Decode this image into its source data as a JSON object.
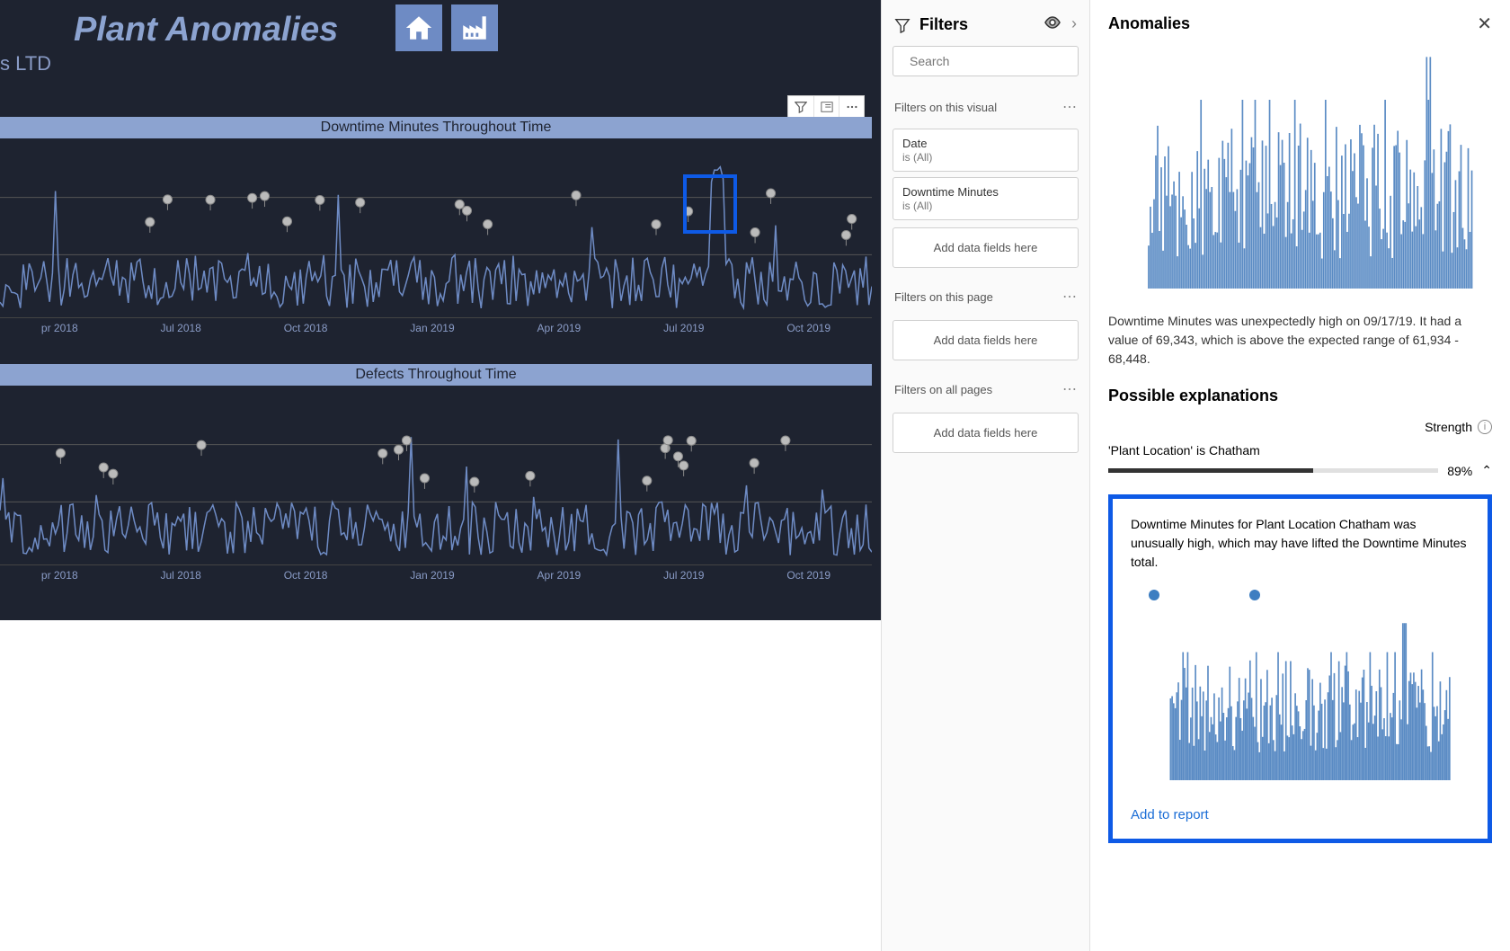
{
  "report": {
    "title": "Plant Anomalies",
    "subtitle": "s LTD"
  },
  "visual_header": {
    "filter": "filter",
    "focus": "focus",
    "more": "more"
  },
  "chart1": {
    "title": "Downtime Minutes Throughout Time",
    "x_labels": [
      "pr 2018",
      "Jul 2018",
      "Oct 2018",
      "Jan 2019",
      "Apr 2019",
      "Jul 2019",
      "Oct 2019"
    ]
  },
  "chart2": {
    "title": "Defects Throughout Time",
    "x_labels": [
      "pr 2018",
      "Jul 2018",
      "Oct 2018",
      "Jan 2019",
      "Apr 2019",
      "Jul 2019",
      "Oct 2019"
    ]
  },
  "filters": {
    "header": "Filters",
    "search_placeholder": "Search",
    "sections": {
      "visual": "Filters on this visual",
      "page": "Filters on this page",
      "all": "Filters on all pages"
    },
    "add_text": "Add data fields here",
    "cards": [
      {
        "title": "Date",
        "sub": "is (All)"
      },
      {
        "title": "Downtime Minutes",
        "sub": "is (All)"
      }
    ]
  },
  "anomalies": {
    "header": "Anomalies",
    "description": "Downtime Minutes was unexpectedly high on 09/17/19. It had a value of 69,343, which is above the expected range of 61,934 - 68,448.",
    "possible_explanations": "Possible explanations",
    "strength_label": "Strength",
    "explanation_label": "'Plant Location' is Chatham",
    "strength_pct": "89%",
    "explanation_text": "Downtime Minutes for Plant Location Chatham was unusually high, which may have lifted the Downtime Minutes total.",
    "add_to_report": "Add to report"
  },
  "chart_data": [
    {
      "type": "line",
      "title": "Downtime Minutes Throughout Time",
      "xlabel": "",
      "ylabel": "",
      "x_range": [
        "Apr 2018",
        "Dec 2019"
      ],
      "series": [
        {
          "name": "Downtime Minutes",
          "description": "daily time series with anomaly markers; spike near Sep 2019 ≈ 69343"
        }
      ],
      "anomaly_highlighted": {
        "date": "09/17/19",
        "value": 69343,
        "expected_range": [
          61934,
          68448
        ]
      }
    },
    {
      "type": "line",
      "title": "Defects Throughout Time",
      "xlabel": "",
      "ylabel": "",
      "x_range": [
        "Apr 2018",
        "Dec 2019"
      ],
      "series": [
        {
          "name": "Defects",
          "description": "daily time series with anomaly markers"
        }
      ]
    },
    {
      "type": "line",
      "title": "Anomalies mini-chart (Downtime Minutes)",
      "series": [
        {
          "name": "Downtime Minutes",
          "description": "dense bar-like series with peak near right side"
        }
      ]
    },
    {
      "type": "line",
      "title": "Plant Location Chatham — Downtime Minutes",
      "series": [
        {
          "name": "Chatham",
          "description": "dense series with large spike near right edge"
        }
      ]
    }
  ]
}
